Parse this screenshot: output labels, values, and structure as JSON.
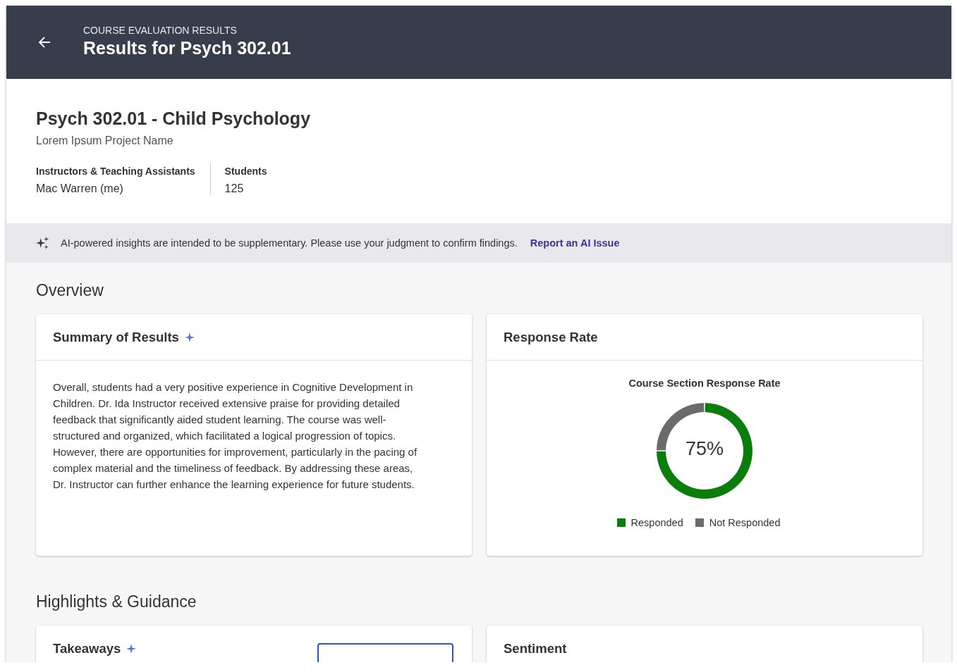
{
  "header": {
    "eyebrow": "COURSE EVALUATION RESULTS",
    "title": "Results for Psych 302.01"
  },
  "course": {
    "title": "Psych 302.01 - Child Psychology",
    "project": "Lorem Ipsum Project Name",
    "facts": [
      {
        "label": "Instructors & Teaching Assistants",
        "value": "Mac Warren (me)"
      },
      {
        "label": "Students",
        "value": "125"
      }
    ]
  },
  "notice": {
    "text": "AI-powered insights are intended to be supplementary. Please use your judgment to confirm findings.",
    "link": "Report an AI Issue"
  },
  "sections": [
    {
      "heading": "Overview",
      "cards": [
        {
          "kind": "text",
          "title": "Summary of Results",
          "ai": true,
          "body": "Overall, students had a very positive experience in Cognitive Development in Children. Dr. Ida Instructor received extensive praise for providing detailed feedback that significantly aided student learning. The course was well-structured and organized, which facilitated a logical progression of topics. However, there are opportunities for improvement, particularly in the pacing of complex material and the timeliness of feedback. By addressing these areas, Dr. Instructor can further enhance the learning experience for future students."
        },
        {
          "kind": "chart",
          "title": "Response Rate",
          "ai": false,
          "center": "75%",
          "chart_data": {
            "type": "donut",
            "title": "Course Section Response Rate",
            "categories": [
              "Responded",
              "Not Responded"
            ],
            "values": [
              75,
              25
            ],
            "colors": [
              "#0a7d0a",
              "#6b6b6b"
            ],
            "legend": "bottom"
          }
        }
      ]
    },
    {
      "heading": "Highlights & Guidance",
      "cards": [
        {
          "kind": "cut",
          "title": "Takeaways",
          "ai": true,
          "button": true
        },
        {
          "kind": "cut",
          "title": "Sentiment",
          "ai": false,
          "button": false
        }
      ]
    }
  ]
}
